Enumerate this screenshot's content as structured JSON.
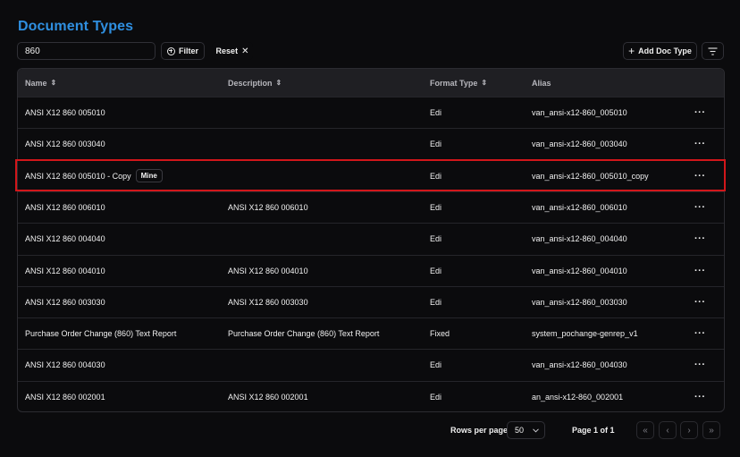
{
  "header": {
    "title": "Document Types"
  },
  "toolbar": {
    "search_value": "860",
    "filter_label": "Filter",
    "reset_label": "Reset",
    "add_label": "Add Doc Type"
  },
  "table": {
    "columns": [
      "Name",
      "Description",
      "Format Type",
      "Alias"
    ],
    "rows": [
      {
        "name": "ANSI X12 860 005010",
        "description": "",
        "format": "Edi",
        "alias": "van_ansi-x12-860_005010"
      },
      {
        "name": "ANSI X12 860 003040",
        "description": "",
        "format": "Edi",
        "alias": "van_ansi-x12-860_003040"
      },
      {
        "name": "ANSI X12 860 005010 - Copy",
        "badge": "Mine",
        "description": "",
        "format": "Edi",
        "alias": "van_ansi-x12-860_005010_copy",
        "highlighted": true
      },
      {
        "name": "ANSI X12 860 006010",
        "description": "ANSI X12 860 006010",
        "format": "Edi",
        "alias": "van_ansi-x12-860_006010"
      },
      {
        "name": "ANSI X12 860 004040",
        "description": "",
        "format": "Edi",
        "alias": "van_ansi-x12-860_004040"
      },
      {
        "name": "ANSI X12 860 004010",
        "description": "ANSI X12 860 004010",
        "format": "Edi",
        "alias": "van_ansi-x12-860_004010"
      },
      {
        "name": "ANSI X12 860 003030",
        "description": "ANSI X12 860 003030",
        "format": "Edi",
        "alias": "van_ansi-x12-860_003030"
      },
      {
        "name": "Purchase Order Change (860) Text Report",
        "description": "Purchase Order Change (860) Text Report",
        "format": "Fixed",
        "alias": "system_pochange-genrep_v1"
      },
      {
        "name": "ANSI X12 860 004030",
        "description": "",
        "format": "Edi",
        "alias": "van_ansi-x12-860_004030"
      },
      {
        "name": "ANSI X12 860 002001",
        "description": "ANSI X12 860 002001",
        "format": "Edi",
        "alias": "an_ansi-x12-860_002001"
      }
    ],
    "row_action": "···"
  },
  "pagination": {
    "rows_per_page_label": "Rows per page",
    "rows_per_page_value": "50",
    "page_label": "Page 1 of 1"
  },
  "colors": {
    "accent": "#2f8fe0",
    "highlight": "#d2161a",
    "background": "#0b0b0d"
  }
}
